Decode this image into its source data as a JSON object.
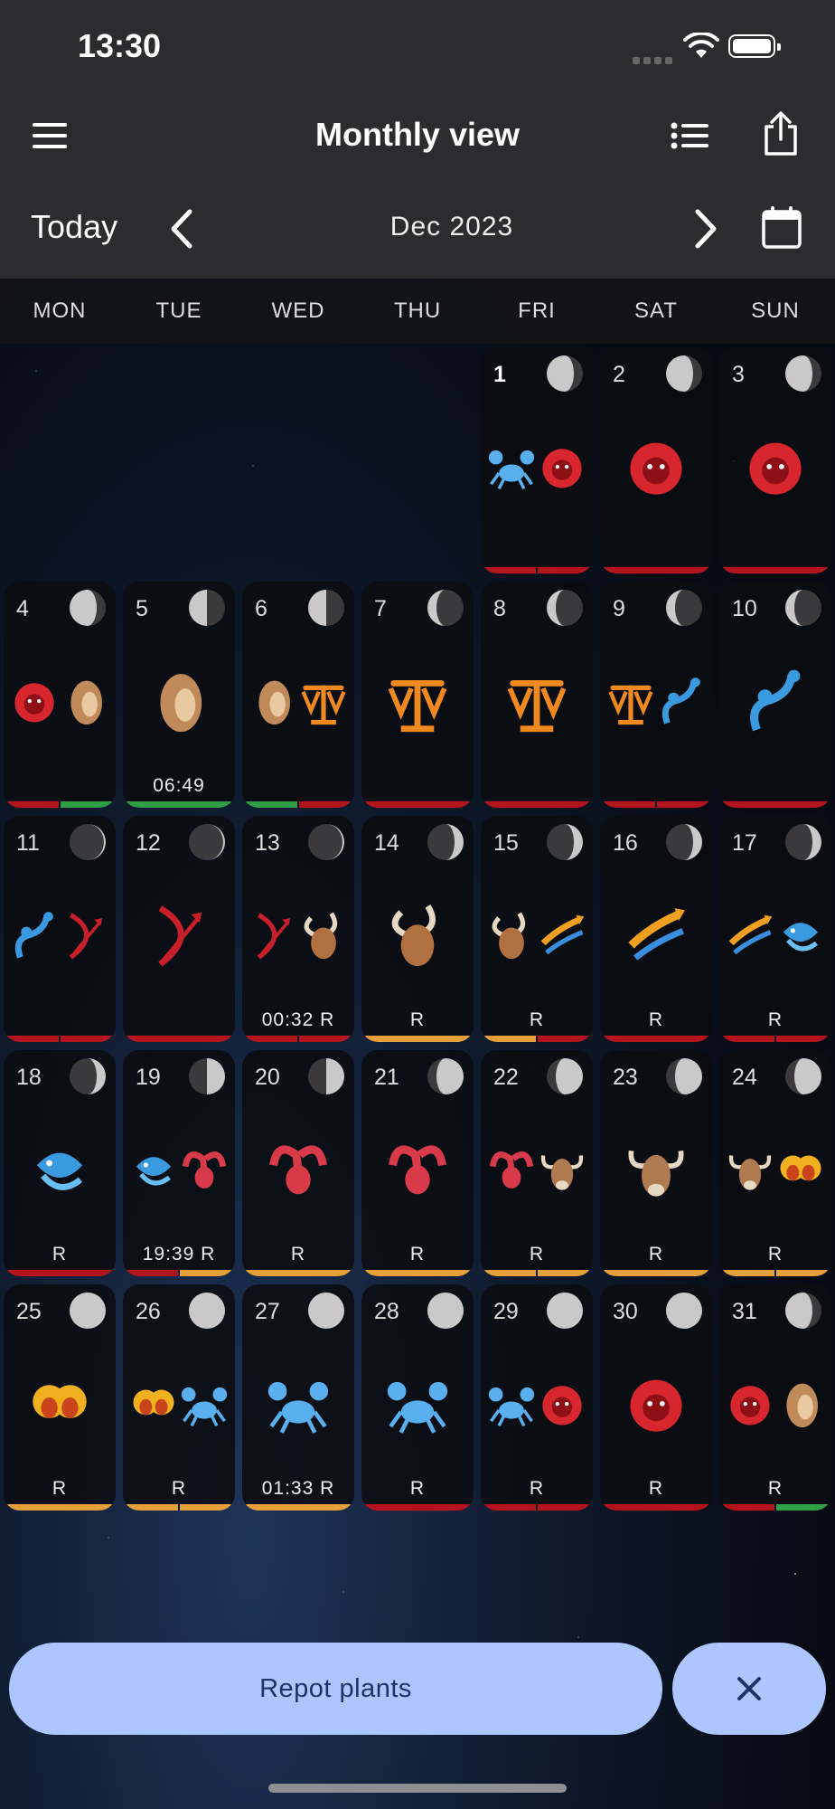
{
  "status": {
    "time": "13:30"
  },
  "header": {
    "title": "Monthly view"
  },
  "nav": {
    "today": "Today",
    "month": "Dec 2023"
  },
  "weekdays": [
    "MON",
    "TUE",
    "WED",
    "THU",
    "FRI",
    "SAT",
    "SUN"
  ],
  "colors": {
    "red": "#b3141e",
    "green": "#2f9e44",
    "orange": "#e5a03a",
    "accent": "#adc6ff"
  },
  "days": [
    {
      "n": "1",
      "col": 4,
      "row": 0,
      "bold": true,
      "moon": "waning-gibbous",
      "signs": [
        "cancer",
        "leo"
      ],
      "label": "",
      "bar": [
        "red",
        "red"
      ]
    },
    {
      "n": "2",
      "col": 5,
      "row": 0,
      "moon": "waning-gibbous",
      "signs": [
        "leo"
      ],
      "label": "",
      "bar": [
        "red"
      ]
    },
    {
      "n": "3",
      "col": 6,
      "row": 0,
      "moon": "waning-gibbous",
      "signs": [
        "leo"
      ],
      "label": "",
      "bar": [
        "red"
      ]
    },
    {
      "n": "4",
      "col": 0,
      "row": 1,
      "moon": "waning-gibbous",
      "signs": [
        "leo",
        "virgo"
      ],
      "label": "",
      "bar": [
        "red",
        "green"
      ]
    },
    {
      "n": "5",
      "col": 1,
      "row": 1,
      "moon": "last-quarter",
      "signs": [
        "virgo"
      ],
      "label": "06:49",
      "bar": [
        "green"
      ]
    },
    {
      "n": "6",
      "col": 2,
      "row": 1,
      "moon": "last-quarter",
      "signs": [
        "virgo",
        "libra"
      ],
      "label": "",
      "bar": [
        "green",
        "red"
      ]
    },
    {
      "n": "7",
      "col": 3,
      "row": 1,
      "moon": "waning-crescent",
      "signs": [
        "libra"
      ],
      "label": "",
      "bar": [
        "red"
      ]
    },
    {
      "n": "8",
      "col": 4,
      "row": 1,
      "moon": "waning-crescent",
      "signs": [
        "libra"
      ],
      "label": "",
      "bar": [
        "red"
      ]
    },
    {
      "n": "9",
      "col": 5,
      "row": 1,
      "moon": "waning-crescent",
      "signs": [
        "libra",
        "scorpio"
      ],
      "label": "",
      "bar": [
        "red",
        "red"
      ]
    },
    {
      "n": "10",
      "col": 6,
      "row": 1,
      "moon": "waning-crescent",
      "signs": [
        "scorpio"
      ],
      "label": "",
      "bar": [
        "red"
      ]
    },
    {
      "n": "11",
      "col": 0,
      "row": 2,
      "moon": "new",
      "signs": [
        "scorpio",
        "sagittarius"
      ],
      "label": "",
      "bar": [
        "red",
        "red"
      ]
    },
    {
      "n": "12",
      "col": 1,
      "row": 2,
      "moon": "new",
      "signs": [
        "sagittarius"
      ],
      "label": "",
      "bar": [
        "red"
      ]
    },
    {
      "n": "13",
      "col": 2,
      "row": 2,
      "moon": "new",
      "signs": [
        "sagittarius",
        "capricorn"
      ],
      "label": "00:32 R",
      "bar": [
        "red",
        "red"
      ]
    },
    {
      "n": "14",
      "col": 3,
      "row": 2,
      "moon": "waxing-crescent",
      "signs": [
        "capricorn"
      ],
      "label": "R",
      "bar": [
        "orange"
      ]
    },
    {
      "n": "15",
      "col": 4,
      "row": 2,
      "moon": "waxing-crescent",
      "signs": [
        "capricorn",
        "aquarius"
      ],
      "label": "R",
      "bar": [
        "orange",
        "red"
      ]
    },
    {
      "n": "16",
      "col": 5,
      "row": 2,
      "moon": "waxing-crescent",
      "signs": [
        "aquarius"
      ],
      "label": "R",
      "bar": [
        "red"
      ]
    },
    {
      "n": "17",
      "col": 6,
      "row": 2,
      "moon": "waxing-crescent",
      "signs": [
        "aquarius",
        "pisces"
      ],
      "label": "R",
      "bar": [
        "red",
        "red"
      ]
    },
    {
      "n": "18",
      "col": 0,
      "row": 3,
      "moon": "waxing-crescent",
      "signs": [
        "pisces"
      ],
      "label": "R",
      "bar": [
        "red"
      ]
    },
    {
      "n": "19",
      "col": 1,
      "row": 3,
      "moon": "first-quarter",
      "signs": [
        "pisces",
        "aries"
      ],
      "label": "19:39 R",
      "bar": [
        "red",
        "orange"
      ]
    },
    {
      "n": "20",
      "col": 2,
      "row": 3,
      "moon": "first-quarter",
      "signs": [
        "aries"
      ],
      "label": "R",
      "bar": [
        "orange"
      ]
    },
    {
      "n": "21",
      "col": 3,
      "row": 3,
      "moon": "waxing-gibbous",
      "signs": [
        "aries"
      ],
      "label": "R",
      "bar": [
        "orange"
      ]
    },
    {
      "n": "22",
      "col": 4,
      "row": 3,
      "moon": "waxing-gibbous",
      "signs": [
        "aries",
        "taurus"
      ],
      "label": "R",
      "bar": [
        "orange",
        "orange"
      ]
    },
    {
      "n": "23",
      "col": 5,
      "row": 3,
      "moon": "waxing-gibbous",
      "signs": [
        "taurus"
      ],
      "label": "R",
      "bar": [
        "orange"
      ]
    },
    {
      "n": "24",
      "col": 6,
      "row": 3,
      "moon": "waxing-gibbous",
      "signs": [
        "taurus",
        "gemini"
      ],
      "label": "R",
      "bar": [
        "orange",
        "orange"
      ]
    },
    {
      "n": "25",
      "col": 0,
      "row": 4,
      "moon": "full",
      "signs": [
        "gemini"
      ],
      "label": "R",
      "bar": [
        "orange"
      ]
    },
    {
      "n": "26",
      "col": 1,
      "row": 4,
      "moon": "full",
      "signs": [
        "gemini",
        "cancer"
      ],
      "label": "R",
      "bar": [
        "orange",
        "orange"
      ]
    },
    {
      "n": "27",
      "col": 2,
      "row": 4,
      "moon": "full",
      "signs": [
        "cancer"
      ],
      "label": "01:33 R",
      "bar": [
        "orange"
      ]
    },
    {
      "n": "28",
      "col": 3,
      "row": 4,
      "moon": "full",
      "signs": [
        "cancer"
      ],
      "label": "R",
      "bar": [
        "red"
      ]
    },
    {
      "n": "29",
      "col": 4,
      "row": 4,
      "moon": "full",
      "signs": [
        "cancer",
        "leo"
      ],
      "label": "R",
      "bar": [
        "red",
        "red"
      ]
    },
    {
      "n": "30",
      "col": 5,
      "row": 4,
      "moon": "full",
      "signs": [
        "leo"
      ],
      "label": "R",
      "bar": [
        "red"
      ]
    },
    {
      "n": "31",
      "col": 6,
      "row": 4,
      "moon": "waning-gibbous",
      "signs": [
        "leo",
        "virgo"
      ],
      "label": "R",
      "bar": [
        "red",
        "green"
      ]
    }
  ],
  "action": {
    "label": "Repot plants"
  }
}
